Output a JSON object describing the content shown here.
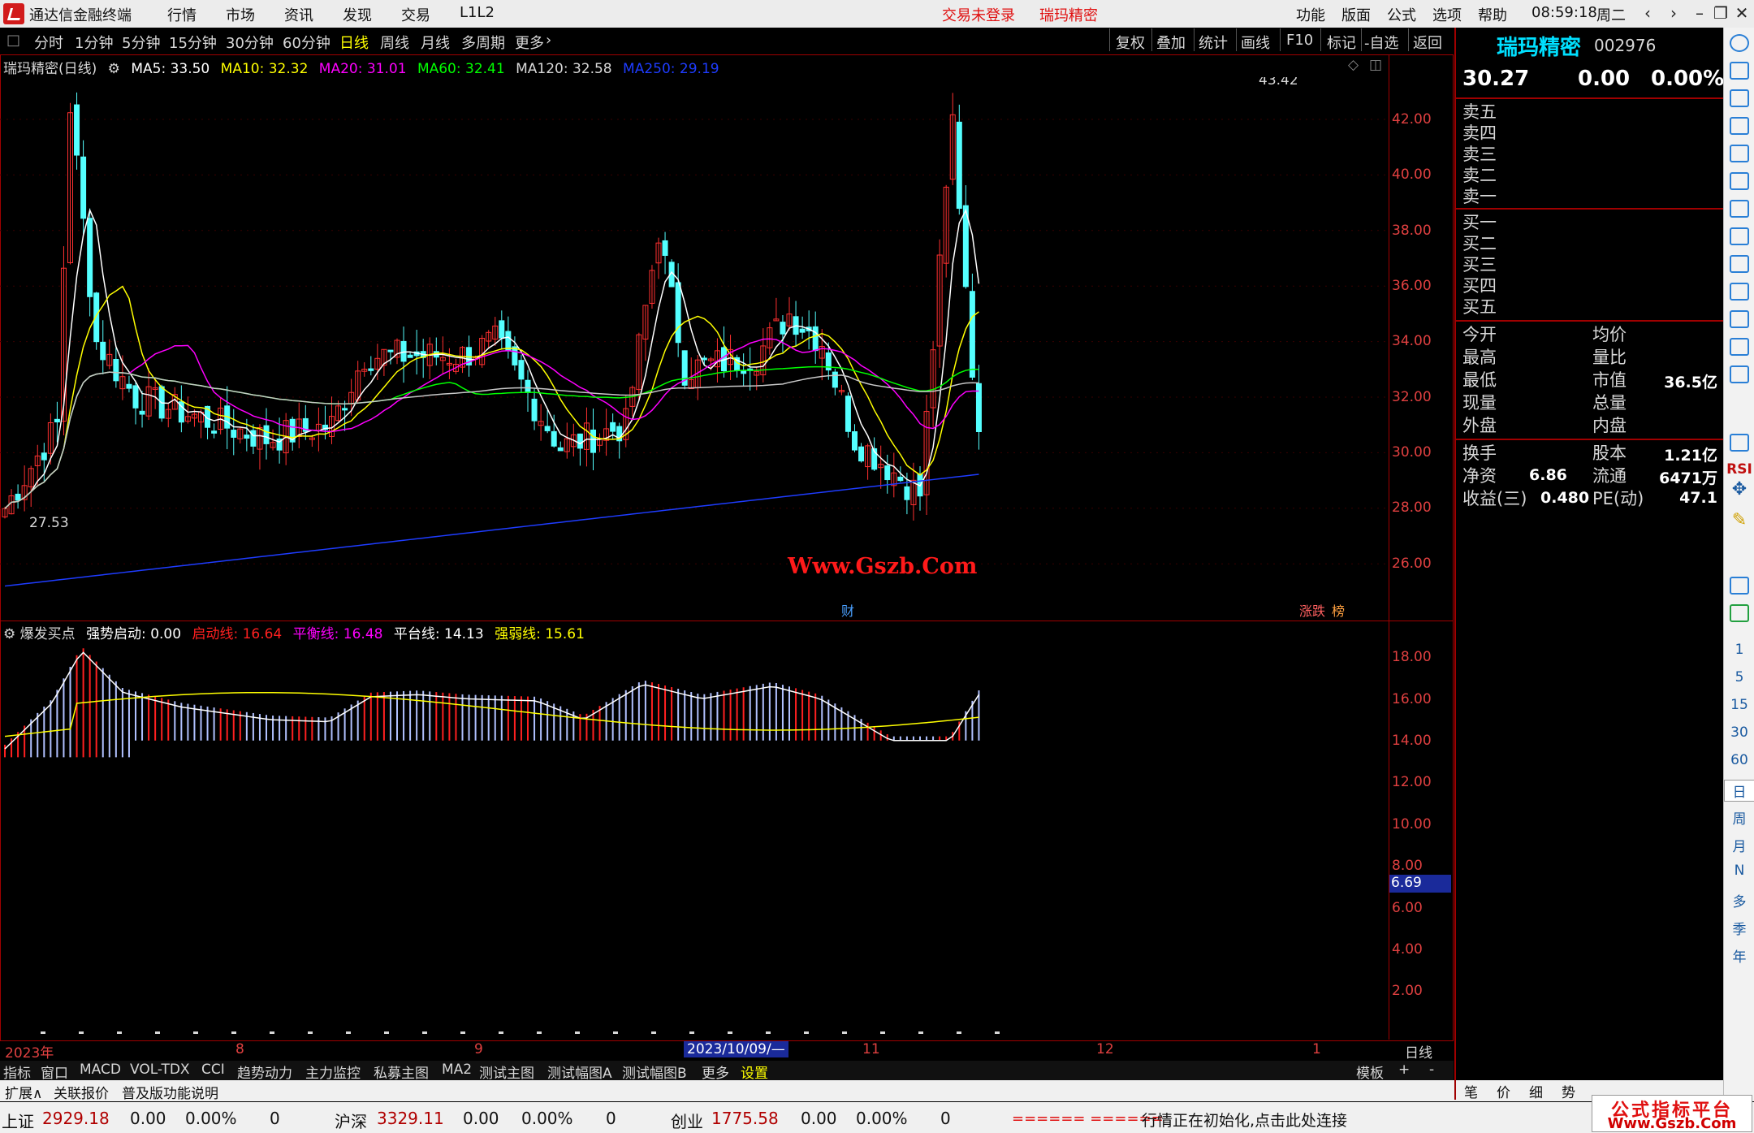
{
  "window": {
    "app_title": "通达信金融终端",
    "menu": [
      "行情",
      "市场",
      "资讯",
      "发现",
      "交易",
      "L1L2"
    ],
    "login_status": "交易未登录",
    "stock_tab": "瑞玛精密",
    "right_menu": [
      "功能",
      "版面",
      "公式",
      "选项",
      "帮助"
    ],
    "clock": "08:59:18",
    "weekday": "周二"
  },
  "periods": [
    "分时",
    "1分钟",
    "5分钟",
    "15分钟",
    "30分钟",
    "60分钟",
    "日线",
    "周线",
    "月线",
    "多周期",
    "更多"
  ],
  "tools": [
    "复权",
    "叠加",
    "统计",
    "画线",
    "F10",
    "标记",
    "-自选",
    "返回"
  ],
  "main": {
    "series_title": "瑞玛精密(日线)",
    "ma": [
      {
        "label": "MA5: 33.50",
        "color": "#ffffff"
      },
      {
        "label": "MA10: 32.32",
        "color": "#ffff00"
      },
      {
        "label": "MA20: 31.01",
        "color": "#ff00ff"
      },
      {
        "label": "MA60: 32.41",
        "color": "#00ff00"
      },
      {
        "label": "MA120: 32.58",
        "color": "#d8d8d8"
      },
      {
        "label": "MA250: 29.19",
        "color": "#1e3cff"
      }
    ],
    "price_ticks": [
      "42.00",
      "40.00",
      "38.00",
      "36.00",
      "34.00",
      "32.00",
      "30.00",
      "28.00",
      "26.00"
    ],
    "high_label": "43.42",
    "low_label": "27.53",
    "badges": [
      "财",
      "涨跌",
      "榜"
    ]
  },
  "watermark": "Www.Gszb.Com",
  "sub": {
    "name": "爆发买点",
    "items": [
      {
        "label": "强势启动: 0.00",
        "color": "#ffffff"
      },
      {
        "label": "启动线: 16.64",
        "color": "#ff2020"
      },
      {
        "label": "平衡线: 16.48",
        "color": "#ff00ff"
      },
      {
        "label": "平台线: 14.13",
        "color": "#ffffff"
      },
      {
        "label": "强弱线: 15.61",
        "color": "#ffff00"
      }
    ],
    "ticks": [
      "18.00",
      "16.00",
      "14.00",
      "12.00",
      "10.00",
      "8.00",
      "6.00",
      "4.00",
      "2.00"
    ],
    "cursor_value": "6.69"
  },
  "time_axis": {
    "labels": [
      "2023年",
      "8",
      "9",
      "2023/10/09/—",
      "11",
      "12",
      "1"
    ],
    "period": "日线"
  },
  "tabs1": [
    "指标",
    "窗口",
    "MACD",
    "VOL-TDX",
    "CCI",
    "趋势动力",
    "主力监控",
    "私募主图",
    "MA2",
    "测试主图",
    "测试幅图A",
    "测试幅图B",
    "更多",
    "设置"
  ],
  "tabs1_right": [
    "模板",
    "+",
    "-"
  ],
  "tabs2": [
    "扩展∧",
    "关联报价",
    "普及版功能说明"
  ],
  "quote": {
    "name": "瑞玛精密",
    "code": "002976",
    "price": "30.27",
    "change": "0.00",
    "pct": "0.00%",
    "asks": [
      "卖五",
      "卖四",
      "卖三",
      "卖二",
      "卖一"
    ],
    "bids": [
      "买一",
      "买二",
      "买三",
      "买四",
      "买五"
    ],
    "stats_left": [
      "今开",
      "最高",
      "最低",
      "现量",
      "外盘"
    ],
    "stats_right": [
      "均价",
      "量比",
      "市值",
      "总量",
      "内盘"
    ],
    "market_cap": "36.5亿",
    "fin_left": [
      "换手",
      "净资",
      "收益(三)"
    ],
    "fin_right": [
      "股本",
      "流通",
      "PE(动)"
    ],
    "fin_vals": [
      "1.21亿",
      "6.86",
      "6471万",
      "0.480",
      "47.1"
    ],
    "bottom_tabs": [
      "笔",
      "价",
      "细",
      "势"
    ]
  },
  "sidebar_labels": [
    "RSI",
    "1",
    "5",
    "15",
    "30",
    "60",
    "日",
    "周",
    "月",
    "N",
    "多",
    "季",
    "年"
  ],
  "status": [
    {
      "name": "上证",
      "value": "2929.18",
      "chg": "0.00",
      "pct": "0.00%",
      "vol": "0"
    },
    {
      "name": "沪深",
      "value": "3329.11",
      "chg": "0.00",
      "pct": "0.00%",
      "vol": "0"
    },
    {
      "name": "创业",
      "value": "1775.58",
      "chg": "0.00",
      "pct": "0.00%",
      "vol": "0"
    }
  ],
  "status_msg": "行情正在初始化,点击此处连接",
  "status_bar": "====== ======",
  "brand": {
    "line1": "公式指标平台",
    "line2": "Www.Gszb.Com"
  }
}
